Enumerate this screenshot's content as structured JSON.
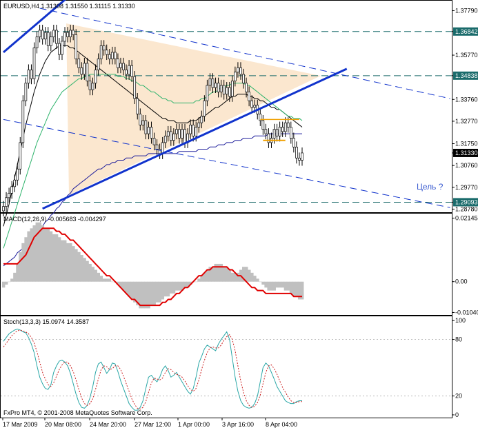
{
  "chart_data": [
    {
      "type": "candlestick",
      "symbol_title": "EURUSD,H4  1.31308 1.31550 1.31115 1.31330",
      "ylim": [
        1.287,
        1.3818
      ],
      "y_ticks": [
        "1.37790",
        "1.36842",
        "1.35770",
        "1.34838",
        "1.33760",
        "1.32770",
        "1.31750",
        "1.31330",
        "1.30760",
        "1.29770",
        "1.29093",
        "1.28780"
      ],
      "h_levels": [
        1.36842,
        1.34838,
        1.29093
      ],
      "h_level_labels": [
        "1.36842",
        "1.34838",
        "1.29093"
      ],
      "current_price": 1.3133,
      "current_price_label": "1.31330",
      "x_ticks": [
        "17 Mar 2009",
        "20 Mar 08:00",
        "24 Mar 20:00",
        "27 Mar 12:00",
        "1 Apr 00:00",
        "3 Apr 16:00",
        "8 Apr 04:00"
      ],
      "annotation": "Цель ?",
      "close": [
        1.289,
        1.293,
        1.295,
        1.298,
        1.301,
        1.306,
        1.318,
        1.337,
        1.345,
        1.351,
        1.347,
        1.361,
        1.366,
        1.369,
        1.365,
        1.368,
        1.362,
        1.366,
        1.369,
        1.363,
        1.358,
        1.364,
        1.368,
        1.366,
        1.369,
        1.367,
        1.356,
        1.352,
        1.349,
        1.354,
        1.346,
        1.342,
        1.345,
        1.351,
        1.356,
        1.362,
        1.36,
        1.358,
        1.356,
        1.359,
        1.356,
        1.352,
        1.354,
        1.351,
        1.349,
        1.353,
        1.348,
        1.338,
        1.331,
        1.326,
        1.328,
        1.322,
        1.325,
        1.32,
        1.317,
        1.315,
        1.313,
        1.318,
        1.321,
        1.323,
        1.319,
        1.322,
        1.324,
        1.32,
        1.324,
        1.318,
        1.322,
        1.326,
        1.321,
        1.325,
        1.327,
        1.33,
        1.337,
        1.344,
        1.347,
        1.343,
        1.345,
        1.341,
        1.344,
        1.34,
        1.343,
        1.339,
        1.346,
        1.35,
        1.352,
        1.349,
        1.345,
        1.341,
        1.337,
        1.334,
        1.335,
        1.331,
        1.328,
        1.324,
        1.322,
        1.318,
        1.32,
        1.324,
        1.321,
        1.325,
        1.323,
        1.327,
        1.325,
        1.32,
        1.316,
        1.311,
        1.31,
        1.3133
      ],
      "series": [
        {
          "name": "",
          "color": "#000000",
          "values": [
            1.28,
            1.285,
            1.29,
            1.296,
            1.302,
            1.308,
            1.314,
            1.32,
            1.326,
            1.331,
            1.336,
            1.341,
            1.345,
            1.349,
            1.352,
            1.355,
            1.357,
            1.359,
            1.36,
            1.361,
            1.362,
            1.362,
            1.362,
            1.362,
            1.361,
            1.361,
            1.36,
            1.359,
            1.358,
            1.357,
            1.356,
            1.355,
            1.354,
            1.353,
            1.352,
            1.351,
            1.35,
            1.349,
            1.348,
            1.347,
            1.346,
            1.345,
            1.344,
            1.343,
            1.342,
            1.341,
            1.34,
            1.339,
            1.338,
            1.337,
            1.336,
            1.335,
            1.334,
            1.333,
            1.332,
            1.331,
            1.33,
            1.329,
            1.329,
            1.328,
            1.328,
            1.328,
            1.327,
            1.327,
            1.327,
            1.327,
            1.327,
            1.328,
            1.328,
            1.328,
            1.329,
            1.33,
            1.33,
            1.331,
            1.332,
            1.333,
            1.334,
            1.334,
            1.335,
            1.336,
            1.337,
            1.338,
            1.339,
            1.339,
            1.34,
            1.34,
            1.34,
            1.34,
            1.339,
            1.339,
            1.338,
            1.338,
            1.337,
            1.337,
            1.336,
            1.335,
            1.334,
            1.334,
            1.333,
            1.333,
            1.332,
            1.331,
            1.33,
            1.329,
            1.328,
            1.327,
            1.326,
            1.325
          ]
        },
        {
          "name": "",
          "color": "#2db36b",
          "values": [
            1.27,
            1.274,
            1.278,
            1.282,
            1.286,
            1.29,
            1.294,
            1.298,
            1.302,
            1.306,
            1.31,
            1.314,
            1.318,
            1.321,
            1.324,
            1.327,
            1.33,
            1.333,
            1.335,
            1.337,
            1.339,
            1.341,
            1.342,
            1.343,
            1.344,
            1.345,
            1.346,
            1.347,
            1.347,
            1.348,
            1.348,
            1.349,
            1.349,
            1.349,
            1.349,
            1.349,
            1.349,
            1.349,
            1.349,
            1.349,
            1.349,
            1.348,
            1.348,
            1.348,
            1.347,
            1.347,
            1.346,
            1.346,
            1.345,
            1.344,
            1.344,
            1.343,
            1.342,
            1.341,
            1.341,
            1.34,
            1.339,
            1.338,
            1.338,
            1.337,
            1.337,
            1.336,
            1.336,
            1.336,
            1.336,
            1.336,
            1.336,
            1.336,
            1.336,
            1.337,
            1.337,
            1.338,
            1.338,
            1.339,
            1.34,
            1.341,
            1.341,
            1.342,
            1.343,
            1.343,
            1.344,
            1.344,
            1.345,
            1.345,
            1.345,
            1.345,
            1.345,
            1.344,
            1.344,
            1.343,
            1.342,
            1.341,
            1.34,
            1.339,
            1.338,
            1.337,
            1.336,
            1.335,
            1.334,
            1.333,
            1.332,
            1.331,
            1.33,
            1.33,
            1.329,
            1.329,
            1.329,
            1.328
          ]
        },
        {
          "name": "",
          "color": "#1f1f9c",
          "values": [
            1.262,
            1.263,
            1.264,
            1.265,
            1.266,
            1.268,
            1.269,
            1.27,
            1.272,
            1.273,
            1.274,
            1.276,
            1.277,
            1.279,
            1.28,
            1.282,
            1.283,
            1.285,
            1.286,
            1.288,
            1.289,
            1.291,
            1.292,
            1.294,
            1.295,
            1.297,
            1.298,
            1.299,
            1.3,
            1.301,
            1.302,
            1.303,
            1.304,
            1.305,
            1.306,
            1.306,
            1.307,
            1.308,
            1.308,
            1.309,
            1.309,
            1.31,
            1.31,
            1.31,
            1.311,
            1.311,
            1.311,
            1.312,
            1.312,
            1.312,
            1.312,
            1.312,
            1.313,
            1.313,
            1.313,
            1.313,
            1.313,
            1.313,
            1.313,
            1.313,
            1.313,
            1.313,
            1.313,
            1.314,
            1.314,
            1.314,
            1.314,
            1.314,
            1.314,
            1.314,
            1.315,
            1.315,
            1.315,
            1.315,
            1.316,
            1.316,
            1.316,
            1.317,
            1.317,
            1.317,
            1.318,
            1.318,
            1.318,
            1.319,
            1.319,
            1.319,
            1.32,
            1.32,
            1.32,
            1.32,
            1.321,
            1.321,
            1.321,
            1.321,
            1.321,
            1.322,
            1.322,
            1.322,
            1.322,
            1.322,
            1.322,
            1.322,
            1.322,
            1.322,
            1.322,
            1.322,
            1.322,
            1.322
          ]
        }
      ]
    },
    {
      "type": "bar",
      "title": "MACD(12,26,9) -0.005683 -0.004297",
      "ylim": [
        -0.011,
        0.0225
      ],
      "y_ticks": [
        "0.021454",
        "0.00",
        "-0.010404"
      ],
      "values": [
        -0.002,
        -0.001,
        0.0,
        0.001,
        0.003,
        0.006,
        0.01,
        0.013,
        0.015,
        0.017,
        0.018,
        0.019,
        0.02,
        0.02,
        0.019,
        0.018,
        0.018,
        0.017,
        0.016,
        0.016,
        0.015,
        0.014,
        0.014,
        0.013,
        0.013,
        0.012,
        0.011,
        0.01,
        0.009,
        0.008,
        0.007,
        0.006,
        0.005,
        0.004,
        0.003,
        0.002,
        0.001,
        0.001,
        0.001,
        0.0,
        0.0,
        -0.001,
        -0.002,
        -0.003,
        -0.004,
        -0.005,
        -0.006,
        -0.007,
        -0.008,
        -0.009,
        -0.009,
        -0.009,
        -0.009,
        -0.008,
        -0.008,
        -0.007,
        -0.007,
        -0.006,
        -0.005,
        -0.005,
        -0.004,
        -0.004,
        -0.003,
        -0.003,
        -0.003,
        -0.002,
        -0.002,
        -0.001,
        0.0,
        0.0,
        0.001,
        0.002,
        0.003,
        0.004,
        0.005,
        0.005,
        0.006,
        0.006,
        0.006,
        0.005,
        0.005,
        0.004,
        0.003,
        0.003,
        0.003,
        0.004,
        0.005,
        0.005,
        0.004,
        0.003,
        0.002,
        0.001,
        0.0,
        -0.001,
        -0.002,
        -0.003,
        -0.003,
        -0.003,
        -0.002,
        -0.002,
        -0.002,
        -0.003,
        -0.003,
        -0.004,
        -0.005,
        -0.005,
        -0.006,
        -0.006
      ],
      "signal": [
        0.006,
        0.006,
        0.006,
        0.006,
        0.006,
        0.006,
        0.007,
        0.008,
        0.009,
        0.011,
        0.013,
        0.015,
        0.016,
        0.017,
        0.018,
        0.018,
        0.018,
        0.018,
        0.018,
        0.017,
        0.017,
        0.016,
        0.016,
        0.015,
        0.014,
        0.014,
        0.013,
        0.012,
        0.011,
        0.01,
        0.009,
        0.008,
        0.007,
        0.006,
        0.005,
        0.004,
        0.003,
        0.002,
        0.002,
        0.001,
        0.0,
        -0.001,
        -0.002,
        -0.003,
        -0.004,
        -0.005,
        -0.006,
        -0.006,
        -0.007,
        -0.008,
        -0.008,
        -0.008,
        -0.008,
        -0.008,
        -0.008,
        -0.008,
        -0.008,
        -0.007,
        -0.007,
        -0.006,
        -0.006,
        -0.005,
        -0.004,
        -0.004,
        -0.003,
        -0.002,
        -0.002,
        -0.001,
        0.0,
        0.001,
        0.002,
        0.002,
        0.003,
        0.004,
        0.004,
        0.005,
        0.005,
        0.005,
        0.005,
        0.005,
        0.005,
        0.004,
        0.004,
        0.003,
        0.002,
        0.002,
        0.001,
        0.0,
        -0.001,
        -0.002,
        -0.002,
        -0.003,
        -0.003,
        -0.003,
        -0.004,
        -0.004,
        -0.004,
        -0.004,
        -0.004,
        -0.004,
        -0.004,
        -0.004,
        -0.004,
        -0.004,
        -0.005,
        -0.005,
        -0.005,
        -0.005
      ]
    },
    {
      "type": "line",
      "title": "Stoch(13,3,3) 15.0974 14.3587",
      "ylim": [
        0,
        100
      ],
      "y_ticks": [
        "100",
        "80",
        "20",
        "0"
      ],
      "series": [
        {
          "name": "",
          "color": "#2aa7a7",
          "values": [
            78,
            82,
            86,
            88,
            90,
            91,
            90,
            88,
            87,
            82,
            75,
            66,
            52,
            40,
            33,
            28,
            27,
            32,
            45,
            52,
            57,
            58,
            56,
            52,
            44,
            33,
            22,
            13,
            8,
            7,
            10,
            18,
            30,
            45,
            54,
            56,
            50,
            44,
            48,
            55,
            54,
            46,
            36,
            28,
            20,
            12,
            8,
            5,
            5,
            8,
            15,
            28,
            40,
            42,
            38,
            35,
            40,
            48,
            52,
            47,
            40,
            42,
            45,
            40,
            35,
            30,
            25,
            22,
            28,
            40,
            55,
            62,
            70,
            74,
            72,
            70,
            68,
            75,
            80,
            84,
            88,
            80,
            60,
            40,
            25,
            15,
            10,
            8,
            7,
            8,
            12,
            20,
            35,
            50,
            55,
            52,
            45,
            38,
            30,
            25,
            20,
            15,
            13,
            12,
            12,
            14,
            15,
            15
          ]
        },
        {
          "name": "",
          "color": "#cc2222",
          "values": [
            72,
            76,
            80,
            84,
            87,
            89,
            90,
            89,
            88,
            86,
            82,
            76,
            67,
            56,
            45,
            38,
            32,
            30,
            34,
            41,
            48,
            53,
            56,
            56,
            52,
            46,
            37,
            27,
            18,
            12,
            10,
            12,
            17,
            27,
            38,
            48,
            52,
            51,
            48,
            49,
            52,
            52,
            48,
            41,
            33,
            25,
            17,
            11,
            7,
            6,
            8,
            14,
            24,
            34,
            39,
            38,
            37,
            39,
            45,
            49,
            48,
            45,
            43,
            42,
            40,
            36,
            31,
            27,
            25,
            28,
            37,
            48,
            58,
            66,
            71,
            72,
            71,
            71,
            74,
            79,
            83,
            85,
            80,
            68,
            52,
            36,
            24,
            15,
            10,
            8,
            9,
            13,
            21,
            33,
            45,
            52,
            53,
            49,
            43,
            36,
            29,
            24,
            19,
            15,
            13,
            13,
            14,
            14
          ]
        }
      ]
    }
  ],
  "footer_text": "FxPro MT4, © 2001-2008 MetaQuotes Software Corp."
}
